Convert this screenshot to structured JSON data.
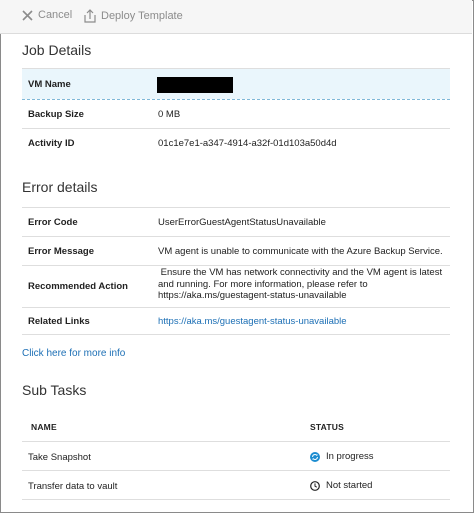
{
  "toolbar": {
    "cancel_label": "Cancel",
    "deploy_label": "Deploy Template"
  },
  "job_details": {
    "title": "Job Details",
    "rows": [
      {
        "label": "VM Name",
        "value": ""
      },
      {
        "label": "Backup Size",
        "value": "0 MB"
      },
      {
        "label": "Activity ID",
        "value": "01c1e7e1-a347-4914-a32f-01d103a50d4d"
      }
    ]
  },
  "error_details": {
    "title": "Error details",
    "rows": [
      {
        "label": "Error Code",
        "value": "UserErrorGuestAgentStatusUnavailable"
      },
      {
        "label": "Error Message",
        "value": "VM agent is unable to communicate with the Azure Backup Service."
      },
      {
        "label": "Recommended Action",
        "value_lines": [
          " Ensure the VM has network connectivity and the VM agent is latest",
          "and running. For more information, please refer to",
          "https://aka.ms/guestagent-status-unavailable"
        ]
      },
      {
        "label": "Related Links",
        "value": "https://aka.ms/guestagent-status-unavailable"
      }
    ]
  },
  "more_info_link": "Click here for more info",
  "sub_tasks": {
    "title": "Sub Tasks",
    "columns": [
      "NAME",
      "STATUS"
    ],
    "rows": [
      {
        "name": "Take Snapshot",
        "status": "In progress",
        "status_icon": "in-progress-icon"
      },
      {
        "name": "Transfer data to vault",
        "status": "Not started",
        "status_icon": "clock-icon"
      }
    ]
  },
  "colors": {
    "link": "#1c6fb5",
    "highlight_row": "#eaf6fc",
    "in_progress": "#1c8cd0"
  }
}
